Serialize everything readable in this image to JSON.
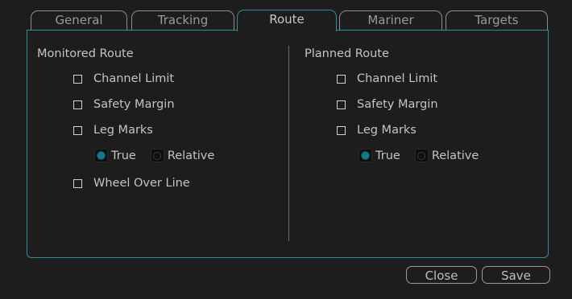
{
  "tabs": [
    {
      "label": "General",
      "active": false
    },
    {
      "label": "Tracking",
      "active": false
    },
    {
      "label": "Route",
      "active": true
    },
    {
      "label": "Mariner",
      "active": false
    },
    {
      "label": "Targets",
      "active": false
    }
  ],
  "monitored_route": {
    "title": "Monitored Route",
    "channel_limit": {
      "label": "Channel Limit",
      "checked": false
    },
    "safety_margin": {
      "label": "Safety Margin",
      "checked": false
    },
    "leg_marks": {
      "label": "Leg Marks",
      "checked": false
    },
    "leg_marks_mode": {
      "true_label": "True",
      "relative_label": "Relative",
      "selected": "True"
    },
    "wheel_over_line": {
      "label": "Wheel Over Line",
      "checked": false
    }
  },
  "planned_route": {
    "title": "Planned Route",
    "channel_limit": {
      "label": "Channel Limit",
      "checked": false
    },
    "safety_margin": {
      "label": "Safety Margin",
      "checked": false
    },
    "leg_marks": {
      "label": "Leg Marks",
      "checked": false
    },
    "leg_marks_mode": {
      "true_label": "True",
      "relative_label": "Relative",
      "selected": "True"
    }
  },
  "buttons": {
    "close_label": "Close",
    "save_label": "Save"
  },
  "colors": {
    "accent": "#2e8f97",
    "radio_selected": "#127a86",
    "background": "#1d1d1d"
  }
}
